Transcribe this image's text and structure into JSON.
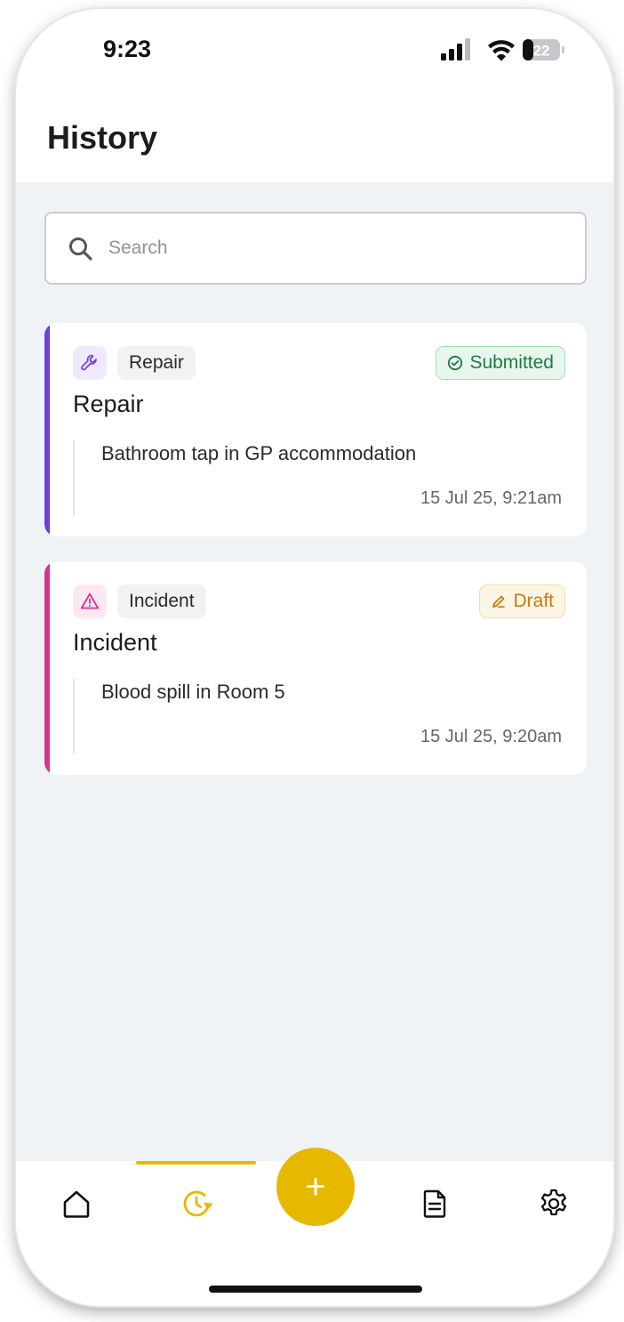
{
  "status_bar": {
    "time": "9:23",
    "battery": "22"
  },
  "header": {
    "title": "History"
  },
  "search": {
    "placeholder": "Search"
  },
  "cards": [
    {
      "type_label": "Repair",
      "status": "Submitted",
      "title": "Repair",
      "description": "Bathroom tap in GP accommodation",
      "timestamp": "15 Jul 25, 9:21am",
      "accent_color": "#6b3fdc",
      "icon": "wrench-icon"
    },
    {
      "type_label": "Incident",
      "status": "Draft",
      "title": "Incident",
      "description": "Blood spill in Room 5",
      "timestamp": "15 Jul 25, 9:20am",
      "accent_color": "#d6338e",
      "icon": "warning-triangle-icon"
    }
  ],
  "tab_bar": {
    "active": "history",
    "items": [
      "home-icon",
      "history-icon",
      "add-icon",
      "document-icon",
      "settings-icon"
    ],
    "fab_label": "+",
    "accent_color": "#e6b800"
  }
}
